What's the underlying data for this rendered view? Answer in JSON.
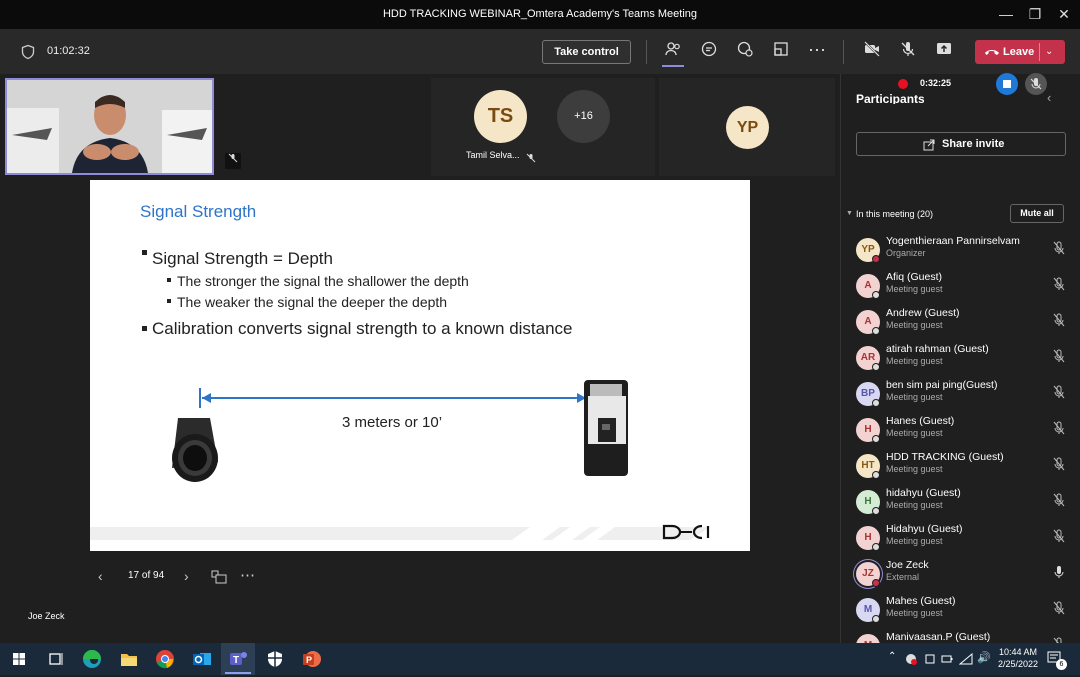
{
  "window": {
    "title": "HDD TRACKING WEBINAR_Omtera Academy's Teams Meeting"
  },
  "toolbar": {
    "meeting_time": "01:02:32",
    "take_control_label": "Take control",
    "leave_label": "Leave"
  },
  "stage": {
    "participant_tile_ts": {
      "initials": "TS",
      "name": "Tamil Selva..."
    },
    "overflow_tile": {
      "label": "+16"
    },
    "participant_tile_yp": {
      "initials": "YP"
    },
    "presenter_name": "Joe Zeck"
  },
  "slide": {
    "title": "Signal Strength",
    "bullets": [
      "Signal Strength = Depth",
      "The stronger the signal the shallower the depth",
      "The weaker the signal the deeper the depth",
      "Calibration converts signal strength to a known distance"
    ],
    "distance_label": "3 meters or 10’",
    "logo_text": "DCI"
  },
  "slide_nav": {
    "page": "17 of 94"
  },
  "recording": {
    "time": "0:32:25"
  },
  "panel": {
    "title": "Participants",
    "share_invite_label": "Share invite",
    "section_label": "In this meeting (20)",
    "mute_all_label": "Mute all",
    "participants": [
      {
        "initials": "YP",
        "name": "Yogenthieraan Pannirselvam",
        "role": "Organizer",
        "color": "#f5e6c8",
        "text": "#8a5a10",
        "status": "#c4314b"
      },
      {
        "initials": "A",
        "name": "Afiq (Guest)",
        "role": "Meeting guest",
        "color": "#f3d2d2",
        "text": "#a33",
        "status": "#ddd"
      },
      {
        "initials": "A",
        "name": "Andrew (Guest)",
        "role": "Meeting guest",
        "color": "#f3d2d2",
        "text": "#a33",
        "status": "#ddd"
      },
      {
        "initials": "AR",
        "name": "atirah rahman (Guest)",
        "role": "Meeting guest",
        "color": "#f3d2d2",
        "text": "#a33",
        "status": "#ddd"
      },
      {
        "initials": "BP",
        "name": "ben sim pai ping(Guest)",
        "role": "Meeting guest",
        "color": "#d8d8f3",
        "text": "#55a",
        "status": "#ddd"
      },
      {
        "initials": "H",
        "name": "Hanes (Guest)",
        "role": "Meeting guest",
        "color": "#f3d2d2",
        "text": "#a33",
        "status": "#ddd"
      },
      {
        "initials": "HT",
        "name": "HDD TRACKING (Guest)",
        "role": "Meeting guest",
        "color": "#f5e6c8",
        "text": "#8a5a10",
        "status": "#ddd"
      },
      {
        "initials": "H",
        "name": "hidahyu (Guest)",
        "role": "Meeting guest",
        "color": "#d4ecd4",
        "text": "#3a7a3a",
        "status": "#ddd"
      },
      {
        "initials": "H",
        "name": "Hidahyu (Guest)",
        "role": "Meeting guest",
        "color": "#f3d2d2",
        "text": "#a33",
        "status": "#ddd"
      },
      {
        "initials": "JZ",
        "name": "Joe Zeck",
        "role": "External",
        "color": "#f3d2d2",
        "text": "#a33",
        "status": "#c4314b"
      },
      {
        "initials": "M",
        "name": "Mahes (Guest)",
        "role": "Meeting guest",
        "color": "#d8d8f3",
        "text": "#55a",
        "status": "#ddd"
      },
      {
        "initials": "M",
        "name": "Manivaasan.P (Guest)",
        "role": "",
        "color": "#f3d2d2",
        "text": "#a33",
        "status": "#ddd"
      }
    ]
  },
  "taskbar": {
    "time": "10:44 AM",
    "date": "2/25/2022",
    "notification_count": "6"
  }
}
